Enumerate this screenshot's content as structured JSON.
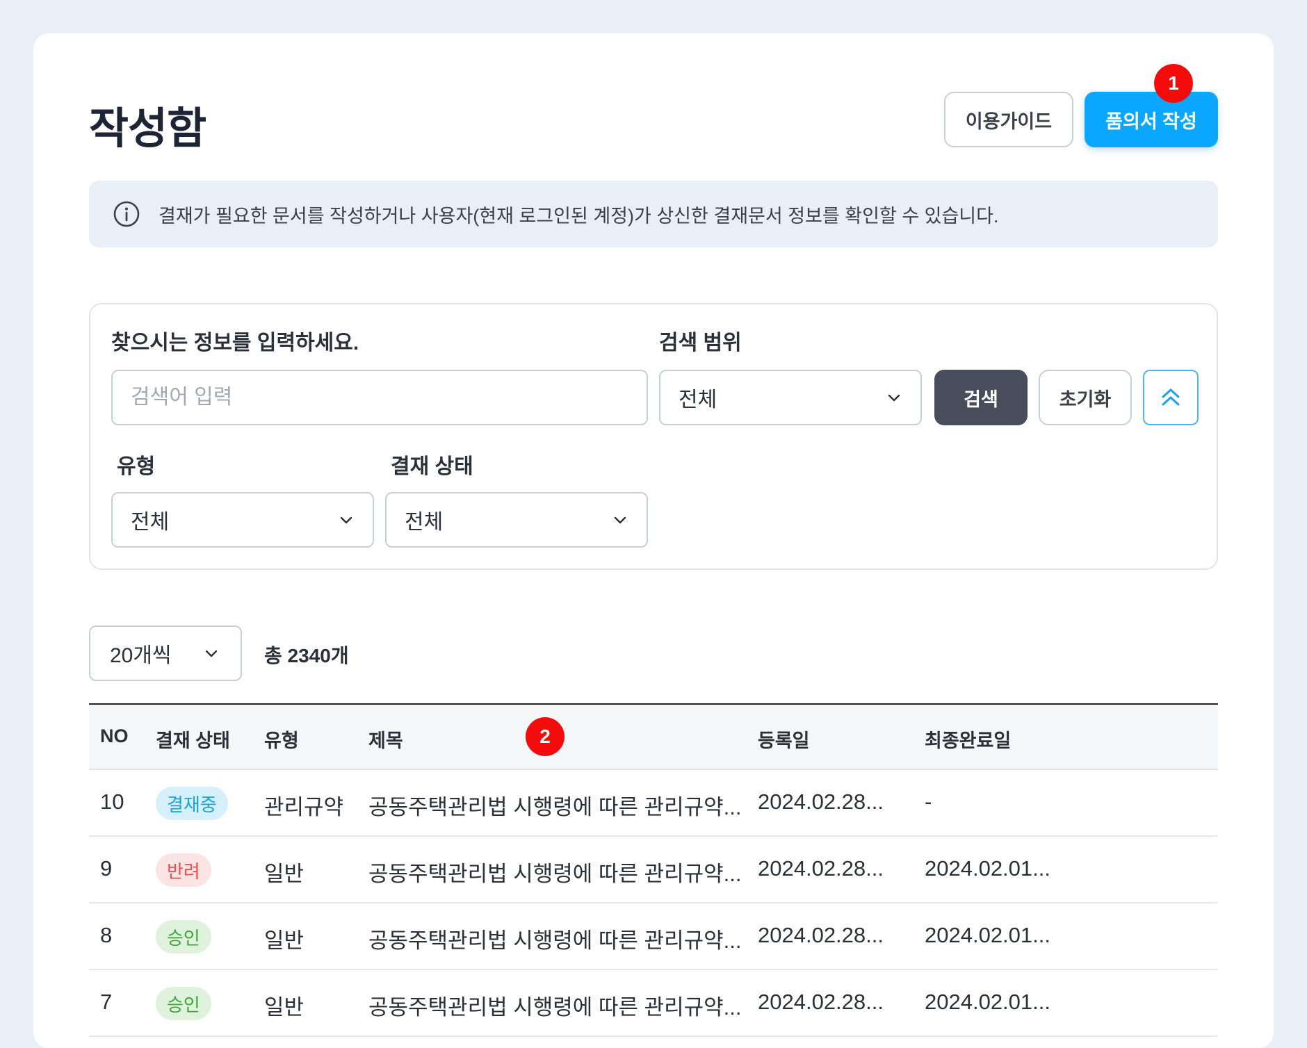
{
  "header": {
    "title": "작성함",
    "guide_label": "이용가이드",
    "create_label": "품의서 작성",
    "marker_1": "1",
    "marker_2": "2"
  },
  "notice": {
    "icon": "info-icon",
    "text": "결재가 필요한 문서를 작성하거나 사용자(현재 로그인된 계정)가 상신한 결재문서 정보를 확인할 수 있습니다."
  },
  "search": {
    "keyword_label": "찾으시는 정보를 입력하세요.",
    "keyword_placeholder": "검색어 입력",
    "keyword_value": "",
    "scope_label": "검색 범위",
    "scope_value": "전체",
    "search_label": "검색",
    "reset_label": "초기화",
    "collapse_icon": "double-chevron-up-icon",
    "type_label": "유형",
    "type_value": "전체",
    "status_label": "결재 상태",
    "status_value": "전체"
  },
  "list": {
    "page_size": "20개씩",
    "total": "총 2340개"
  },
  "table": {
    "columns": [
      "NO",
      "결재 상태",
      "유형",
      "제목",
      "등록일",
      "최종완료일"
    ],
    "rows": [
      {
        "no": "10",
        "status": "결재중",
        "type": "관리규약",
        "title": "공동주택관리법 시행령에 따른 관리규약...",
        "registered": "2024.02.28...",
        "completed": "-"
      },
      {
        "no": "9",
        "status": "반려",
        "type": "일반",
        "title": "공동주택관리법 시행령에 따른 관리규약...",
        "registered": "2024.02.28...",
        "completed": "2024.02.01..."
      },
      {
        "no": "8",
        "status": "승인",
        "type": "일반",
        "title": "공동주택관리법 시행령에 따른 관리규약...",
        "registered": "2024.02.28...",
        "completed": "2024.02.01..."
      },
      {
        "no": "7",
        "status": "승인",
        "type": "일반",
        "title": "공동주택관리법 시행령에 따른 관리규약...",
        "registered": "2024.02.28...",
        "completed": "2024.02.01..."
      }
    ]
  },
  "colors": {
    "primary": "#0aa6ff",
    "dark_button": "#474d5a",
    "marker": "#f40b0b",
    "status_in_progress": "#18a2d8",
    "status_rejected": "#ef4a4a",
    "status_approved": "#3ca63a"
  }
}
